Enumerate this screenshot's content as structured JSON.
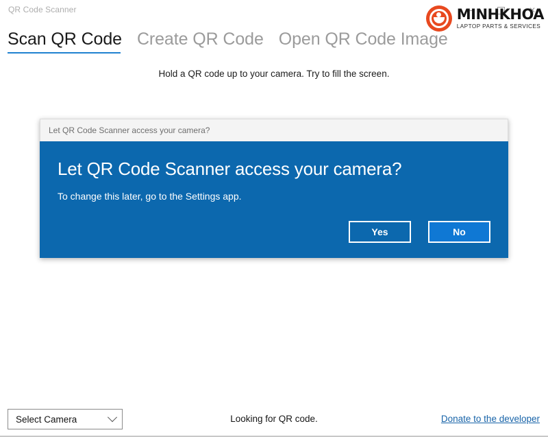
{
  "window": {
    "app_title": "QR Code Scanner",
    "controls": [
      {
        "name": "minimize",
        "glyph": "minimize-icon"
      },
      {
        "name": "maximize",
        "glyph": "maximize-icon"
      },
      {
        "name": "close",
        "glyph": "close-icon",
        "symbol": "✕"
      }
    ]
  },
  "watermark": {
    "brand": "MINHKHOA",
    "tagline": "LAPTOP PARTS & SERVICES",
    "mark_color": "#e8491f"
  },
  "tabs": [
    {
      "label": "Scan QR Code",
      "selected": true
    },
    {
      "label": "Create QR Code",
      "selected": false
    },
    {
      "label": "Open QR Code Image",
      "selected": false
    }
  ],
  "main": {
    "instruction": "Hold a QR code up to your camera. Try to fill the screen."
  },
  "dialog": {
    "titlebar_text": "Let QR Code Scanner access your camera?",
    "heading": "Let QR Code Scanner access your camera?",
    "subtext": "To change this later, go to the Settings app.",
    "buttons": [
      {
        "label": "Yes",
        "focused": false
      },
      {
        "label": "No",
        "focused": true
      }
    ],
    "accent_color": "#0c68ae",
    "focus_color": "#0f78d4"
  },
  "bottombar": {
    "camera_select_label": "Select Camera",
    "status_text": "Looking for QR code.",
    "donate_label": "Donate to the developer",
    "link_color": "#1763a8"
  },
  "theme": {
    "accent": "#1f81d0",
    "background": "#ffffff"
  }
}
